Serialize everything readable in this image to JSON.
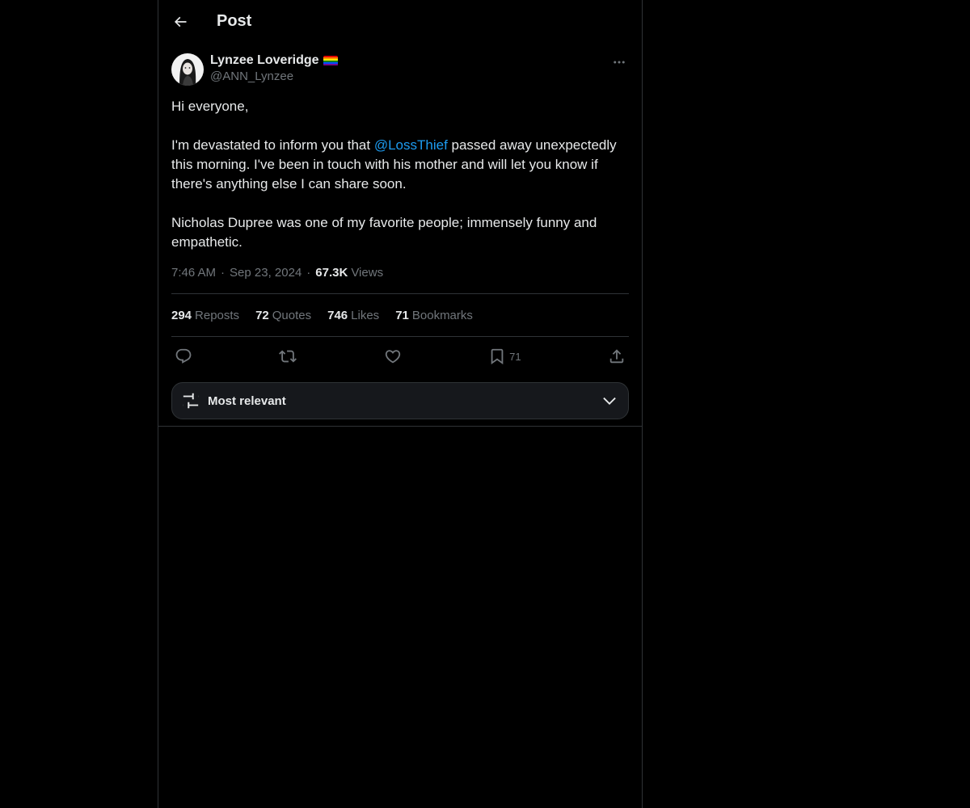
{
  "header": {
    "title": "Post"
  },
  "author": {
    "name": "Lynzee Loveridge",
    "handle": "@ANN_Lynzee",
    "badge_icon": "rainbow-flag-icon"
  },
  "post": {
    "line1": "Hi everyone,",
    "line2_before": "I'm devastated to inform you that ",
    "mention": "@LossThief",
    "line2_after": " passed away unexpectedly this morning. I've been in touch with his mother and will let you know if there's anything else I can share soon.",
    "line3": "Nicholas Dupree was one of my favorite people; immensely funny and empathetic."
  },
  "meta": {
    "time": "7:46 AM",
    "date": "Sep 23, 2024",
    "views_count": "67.3K",
    "views_label": "Views"
  },
  "stats": {
    "reposts_count": "294",
    "reposts_label": "Reposts",
    "quotes_count": "72",
    "quotes_label": "Quotes",
    "likes_count": "746",
    "likes_label": "Likes",
    "bookmarks_count": "71",
    "bookmarks_label": "Bookmarks"
  },
  "actions": {
    "bookmark_count": "71"
  },
  "sort": {
    "label": "Most relevant"
  },
  "colors": {
    "background": "#000000",
    "text": "#e7e9ea",
    "muted": "#71767b",
    "accent": "#1d9bf0",
    "border": "#2f3336"
  }
}
